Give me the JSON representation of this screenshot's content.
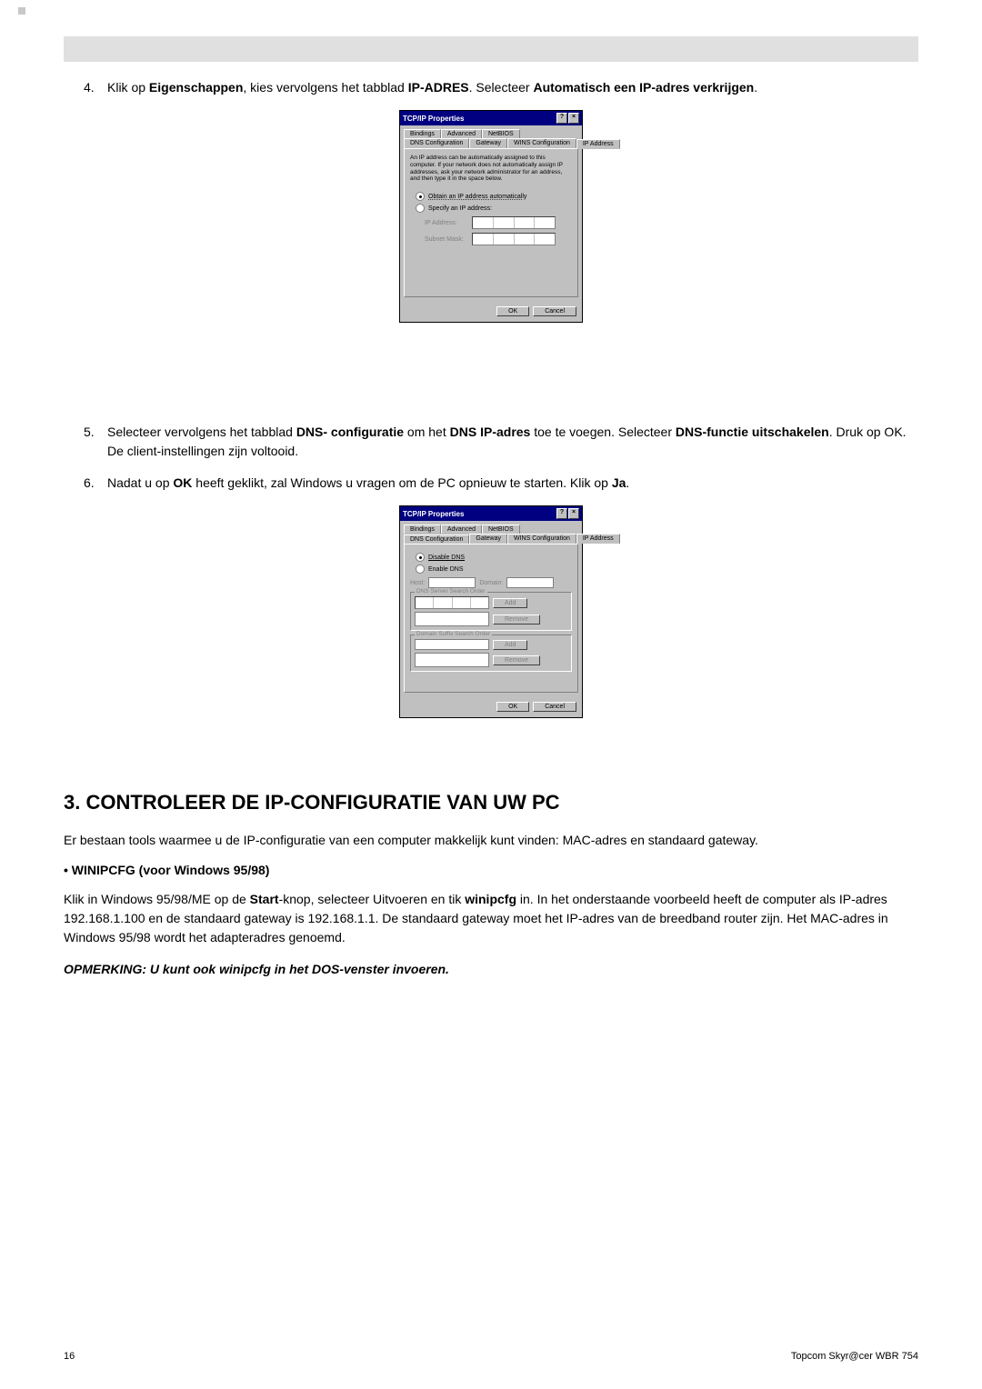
{
  "step4": {
    "num": "4.",
    "t1": "Klik op ",
    "t2": "Eigenschappen",
    "t3": ", kies vervolgens het tabblad ",
    "t4": "IP-ADRES",
    "t5": ". Selecteer ",
    "t6": "Automatisch een IP-adres verkrijgen",
    "t7": "."
  },
  "dlg1": {
    "title": "TCP/IP Properties",
    "help": "?",
    "close": "×",
    "tabs_top": [
      "Bindings",
      "Advanced",
      "NetBIOS"
    ],
    "tabs_bot": [
      "DNS Configuration",
      "Gateway",
      "WINS Configuration",
      "IP Address"
    ],
    "note": "An IP address can be automatically assigned to this computer. If your network does not automatically assign IP addresses, ask your network administrator for an address, and then type it in the space below.",
    "r1": "Obtain an IP address automatically",
    "r2": "Specify an IP address:",
    "lbl_ip": "IP Address:",
    "lbl_mask": "Subnet Mask:",
    "ok": "OK",
    "cancel": "Cancel"
  },
  "step5": {
    "num": "5.",
    "t1": "Selecteer vervolgens  het tabblad ",
    "t2": "DNS- configuratie",
    "t3": " om het ",
    "t4": "DNS IP-adres",
    "t5": " toe te voegen. Selecteer ",
    "t6": "DNS-functie uitschakelen",
    "t7": ". Druk op OK. De client-instellingen zijn voltooid."
  },
  "step6": {
    "num": "6.",
    "t1": "Nadat u op ",
    "t2": "OK",
    "t3": " heeft geklikt, zal Windows u vragen om de PC opnieuw te starten. Klik op ",
    "t4": "Ja",
    "t5": "."
  },
  "dlg2": {
    "title": "TCP/IP Properties",
    "help": "?",
    "close": "×",
    "tabs_top": [
      "Bindings",
      "Advanced",
      "NetBIOS"
    ],
    "tabs_bot": [
      "DNS Configuration",
      "Gateway",
      "WINS Configuration",
      "IP Address"
    ],
    "r1": "Disable DNS",
    "r2": "Enable DNS",
    "host": "Host:",
    "domain": "Domain:",
    "g1": "DNS Server Search Order",
    "g2": "Domain Suffix Search Order",
    "add": "Add",
    "remove": "Remove",
    "ok": "OK",
    "cancel": "Cancel"
  },
  "section3": {
    "heading": "3.  CONTROLEER DE IP-CONFIGURATIE VAN UW PC",
    "para1": "Er bestaan tools waarmee u de IP-configuratie van een computer makkelijk kunt vinden: MAC-adres en standaard gateway.",
    "bullet_dot": "•",
    "bullet_text": " WINIPCFG (voor Windows 95/98)",
    "p2a": "Klik in Windows 95/98/ME op de ",
    "p2b": "Start",
    "p2c": "-knop, selecteer Uitvoeren en tik ",
    "p2d": "winipcfg",
    "p2e": " in. In het onderstaande voorbeeld heeft de computer als IP-adres 192.168.1.100 en de standaard gateway is 192.168.1.1. De standaard gateway moet het IP-adres van de breedband router zijn. Het MAC-adres in Windows 95/98 wordt het adapteradres genoemd.",
    "note": "OPMERKING: U kunt ook winipcfg in het DOS-venster invoeren."
  },
  "footer": {
    "page": "16",
    "product": "Topcom Skyr@cer WBR 754"
  }
}
